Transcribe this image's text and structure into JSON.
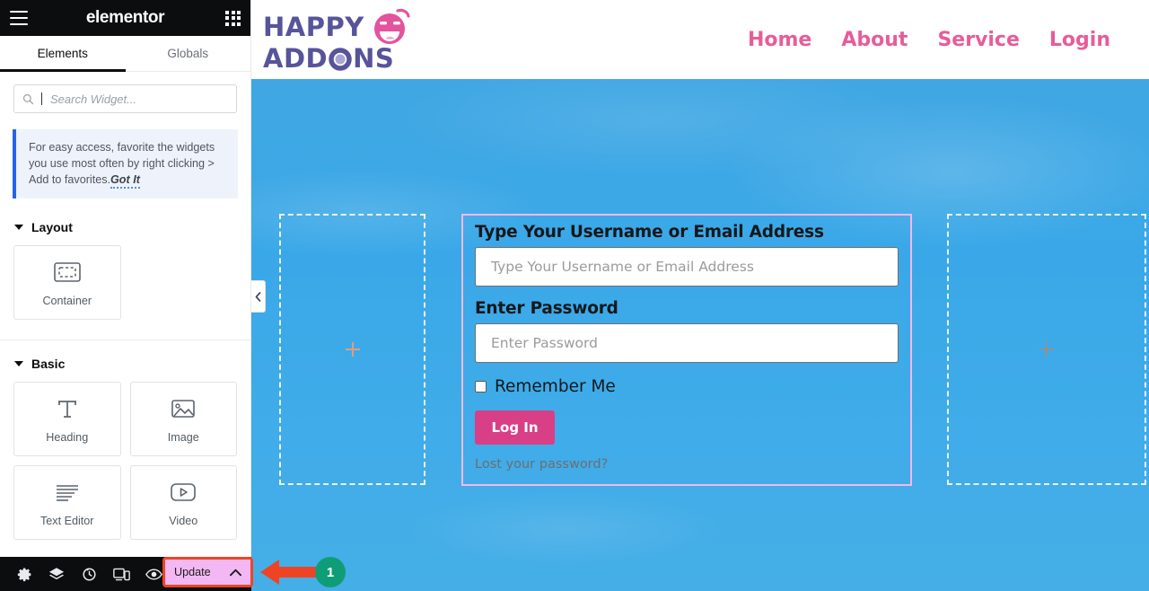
{
  "editor": {
    "brand": "elementor",
    "menu_icon": "hamburger-icon",
    "apps_icon": "apps-grid-icon",
    "tabs": [
      {
        "label": "Elements",
        "active": true
      },
      {
        "label": "Globals",
        "active": false
      }
    ],
    "search": {
      "placeholder": "Search Widget...",
      "value": ""
    },
    "notice": {
      "text": "For easy access, favorite the widgets you use most often by right clicking > Add to favorites.",
      "link_label": "Got It",
      "accent_color": "#2563eb",
      "background": "#eef3fb"
    },
    "sections": [
      {
        "title": "Layout",
        "widgets": [
          {
            "label": "Container",
            "icon": "container-icon"
          }
        ]
      },
      {
        "title": "Basic",
        "widgets": [
          {
            "label": "Heading",
            "icon": "heading-icon"
          },
          {
            "label": "Image",
            "icon": "image-icon"
          },
          {
            "label": "Text Editor",
            "icon": "text-editor-icon"
          },
          {
            "label": "Video",
            "icon": "video-icon"
          }
        ]
      }
    ],
    "collapse_tab_icon": "chevron-left-icon",
    "bottom_bar": {
      "icons": [
        {
          "name": "settings-gear-icon",
          "title": "Settings"
        },
        {
          "name": "layers-navigator-icon",
          "title": "Navigator"
        },
        {
          "name": "history-clock-icon",
          "title": "History"
        },
        {
          "name": "responsive-devices-icon",
          "title": "Responsive Mode"
        },
        {
          "name": "eye-preview-icon",
          "title": "Preview Changes"
        }
      ],
      "update_label": "Update",
      "update_caret_icon": "chevron-up-icon",
      "update_bg": "#f3b8f3",
      "highlight_color": "#ef4424"
    }
  },
  "annotation": {
    "arrow_icon": "arrow-left-icon",
    "arrow_color": "#ef4424",
    "badge_number": "1",
    "badge_color": "#0f9d77"
  },
  "site": {
    "logo": {
      "line1": "HAPPY",
      "line2_a": "ADD",
      "line2_o": "O",
      "line2_b": "NS",
      "face_icon": "happy-wink-face-icon",
      "text_color": "#57549b",
      "face_color": "#e2549e"
    },
    "nav": [
      {
        "label": "Home"
      },
      {
        "label": "About"
      },
      {
        "label": "Service"
      },
      {
        "label": "Login"
      }
    ],
    "nav_color": "#e85c9a",
    "sky_color": "#3aa8e8"
  },
  "login_form": {
    "username_label": "Type Your Username or Email Address",
    "username_placeholder": "Type Your Username or Email Address",
    "username_value": "",
    "password_label": "Enter Password",
    "password_placeholder": "Enter Password",
    "password_value": "",
    "remember_label": "Remember Me",
    "remember_checked": false,
    "submit_label": "Log In",
    "submit_color": "#d83f87",
    "lost_password_label": "Lost your password?",
    "outline_color": "#f4b8ea"
  },
  "placeholders": {
    "left_plus_icon": "plus-icon",
    "right_plus_icon": "plus-icon"
  }
}
